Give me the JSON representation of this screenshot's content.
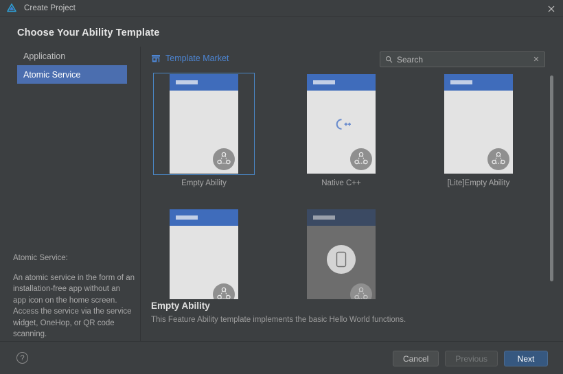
{
  "window": {
    "title": "Create Project",
    "logo_icon": "deveco-logo-icon",
    "close_icon": "close-icon"
  },
  "heading": "Choose Your Ability Template",
  "sidebar": {
    "items": [
      {
        "label": "Application",
        "selected": false
      },
      {
        "label": "Atomic Service",
        "selected": true
      }
    ],
    "description_title": "Atomic Service:",
    "description_body": "An atomic service in the form of an installation-free app without an app icon on the home screen. Access the service via the service widget, OneHop, or QR code scanning."
  },
  "content": {
    "market_link": "Template Market",
    "market_icon": "storefront-icon",
    "search": {
      "placeholder": "Search",
      "value": "",
      "search_icon": "search-icon",
      "clear_icon": "clear-icon"
    },
    "templates": [
      {
        "name": "Empty Ability",
        "selected": true,
        "dimmed": false,
        "badge": "harmony-connect-badge-icon",
        "center_icon": ""
      },
      {
        "name": "Native C++",
        "selected": false,
        "dimmed": false,
        "badge": "harmony-connect-badge-icon",
        "center_icon": "cpp-icon"
      },
      {
        "name": "[Lite]Empty Ability",
        "selected": false,
        "dimmed": false,
        "badge": "harmony-connect-badge-icon",
        "center_icon": ""
      },
      {
        "name": "",
        "selected": false,
        "dimmed": false,
        "badge": "harmony-connect-badge-icon",
        "center_icon": ""
      },
      {
        "name": "",
        "selected": false,
        "dimmed": true,
        "badge": "harmony-connect-badge-icon",
        "center_icon": "phone-icon"
      }
    ],
    "selected_title": "Empty Ability",
    "selected_description": "This Feature Ability template implements the basic Hello World functions."
  },
  "footer": {
    "help_icon": "help-icon",
    "help_label": "?",
    "buttons": [
      {
        "label": "Cancel",
        "style": "normal"
      },
      {
        "label": "Previous",
        "style": "disabled"
      },
      {
        "label": "Next",
        "style": "primary"
      }
    ]
  },
  "colors": {
    "window_bg": "#3c3f41",
    "accent_blue": "#4b6eaf",
    "link_blue": "#4d86d4",
    "primary_button": "#365880",
    "phone_bar": "#3f6cbb"
  }
}
